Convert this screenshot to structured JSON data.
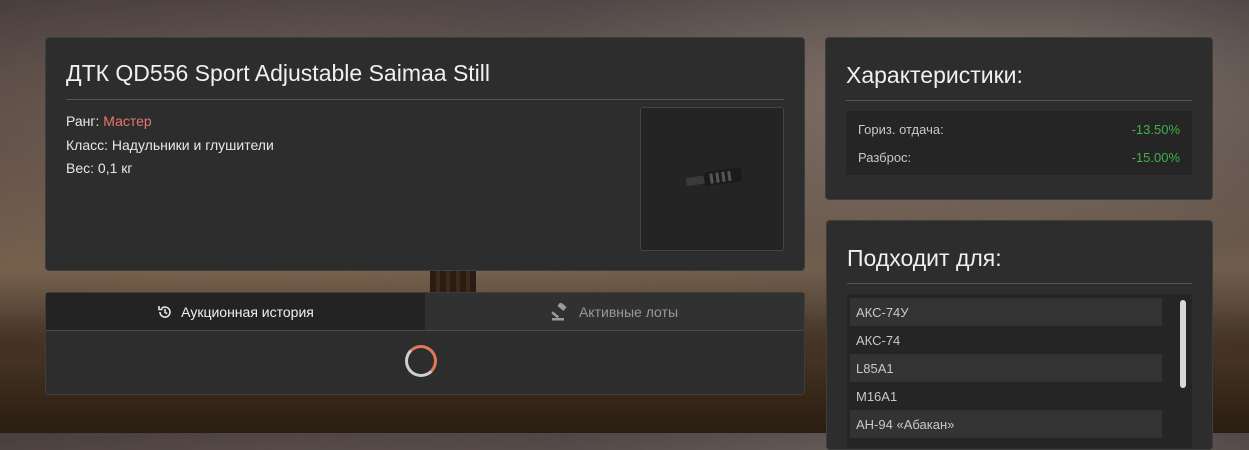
{
  "item": {
    "title": "ДТК QD556 Sport Adjustable Saimaa Still",
    "rank_label": "Ранг:",
    "rank_value": "Мастер",
    "class_label": "Класс:",
    "class_value": "Надульники и глушители",
    "weight_label": "Вес:",
    "weight_value": "0,1 кг"
  },
  "tabs": {
    "history_label": "Аукционная история",
    "lots_label": "Активные лоты",
    "history_icon": "history-icon",
    "lots_icon": "gavel-icon"
  },
  "stats": {
    "title": "Характеристики:",
    "rows": [
      {
        "label": "Гориз. отдача:",
        "value": "-13.50%"
      },
      {
        "label": "Разброс:",
        "value": "-15.00%"
      }
    ]
  },
  "compat": {
    "title": "Подходит для:",
    "items": [
      "АКС-74У",
      "АКС-74",
      "L85A1",
      "M16A1",
      "АН-94 «Абакан»"
    ]
  },
  "colors": {
    "rank": "#e8766b",
    "positive": "#3fb04a",
    "spinner_accent": "#e07a56"
  }
}
